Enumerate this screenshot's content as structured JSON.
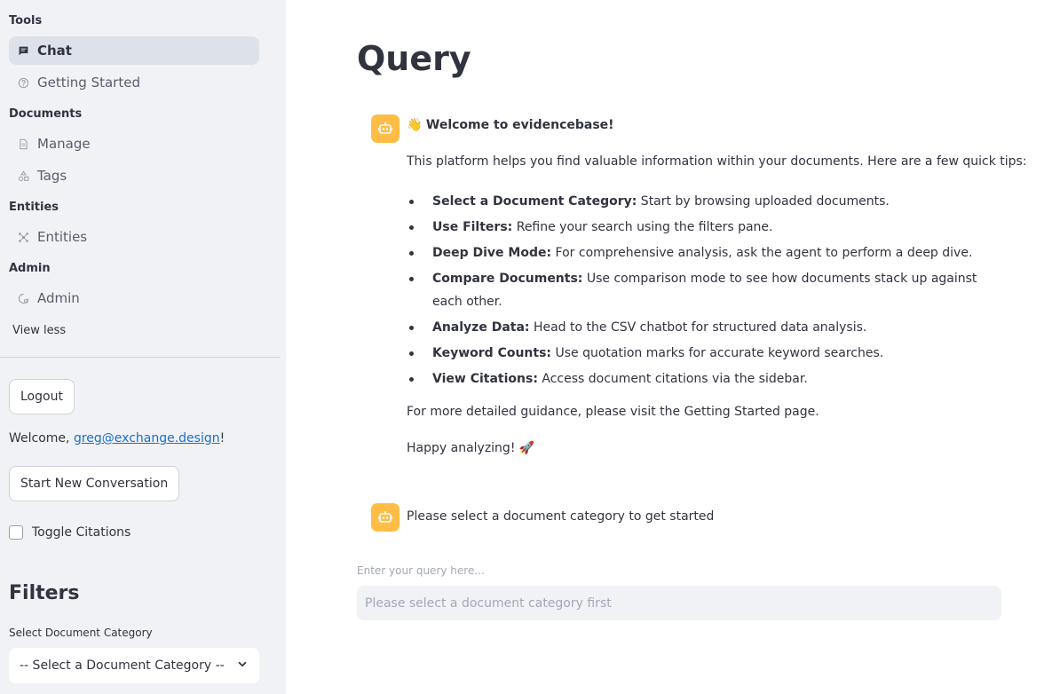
{
  "sidebar": {
    "sections": {
      "tools": "Tools",
      "documents": "Documents",
      "entities": "Entities",
      "admin": "Admin"
    },
    "items": {
      "chat": "Chat",
      "getting_started": "Getting Started",
      "manage": "Manage",
      "tags": "Tags",
      "entities": "Entities",
      "admin": "Admin"
    },
    "active_item": "Chat",
    "view_less": "View less",
    "logout_label": "Logout",
    "welcome_prefix": "Welcome, ",
    "user_email": "greg@exchange.design",
    "welcome_suffix": "!",
    "new_conversation_label": "Start New Conversation",
    "toggle_citations_label": "Toggle Citations",
    "toggle_citations_checked": false,
    "filters_title": "Filters",
    "category_select_label": "Select Document Category",
    "category_select_value": "-- Select a Document Category --"
  },
  "main": {
    "title": "Query",
    "welcome_message": {
      "emoji": "👋",
      "heading": "Welcome to evidencebase!",
      "intro": "This platform helps you find valuable information within your documents. Here are a few quick tips:",
      "tips": [
        {
          "title": "Select a Document Category:",
          "text": " Start by browsing uploaded documents."
        },
        {
          "title": "Use Filters:",
          "text": " Refine your search using the filters pane."
        },
        {
          "title": "Deep Dive Mode:",
          "text": " For comprehensive analysis, ask the agent to perform a deep dive."
        },
        {
          "title": "Compare Documents:",
          "text": " Use comparison mode to see how documents stack up against each other."
        },
        {
          "title": "Analyze Data:",
          "text": " Head to the CSV chatbot for structured data analysis."
        },
        {
          "title": "Keyword Counts:",
          "text": " Use quotation marks for accurate keyword searches."
        },
        {
          "title": "View Citations:",
          "text": " Access document citations via the sidebar."
        }
      ],
      "guidance": "For more detailed guidance, please visit the Getting Started page.",
      "signoff": "Happy analyzing! 🚀"
    },
    "second_message": "Please select a document category to get started",
    "query_label": "Enter your query here...",
    "query_placeholder": "Please select a document category first"
  },
  "colors": {
    "sidebar_bg": "#f0f2f6",
    "active_item_bg": "#dde1ea",
    "avatar_bg": "#ffbd45",
    "link": "#1c6fc6",
    "text": "#31333f"
  },
  "icons": {
    "chat": "chat-bubble-icon",
    "getting_started": "help-circle-icon",
    "manage": "document-icon",
    "tags": "shapes-icon",
    "entities": "network-icon",
    "admin": "admin-gear-icon",
    "avatar": "robot-icon",
    "select": "chevron-down-icon"
  }
}
